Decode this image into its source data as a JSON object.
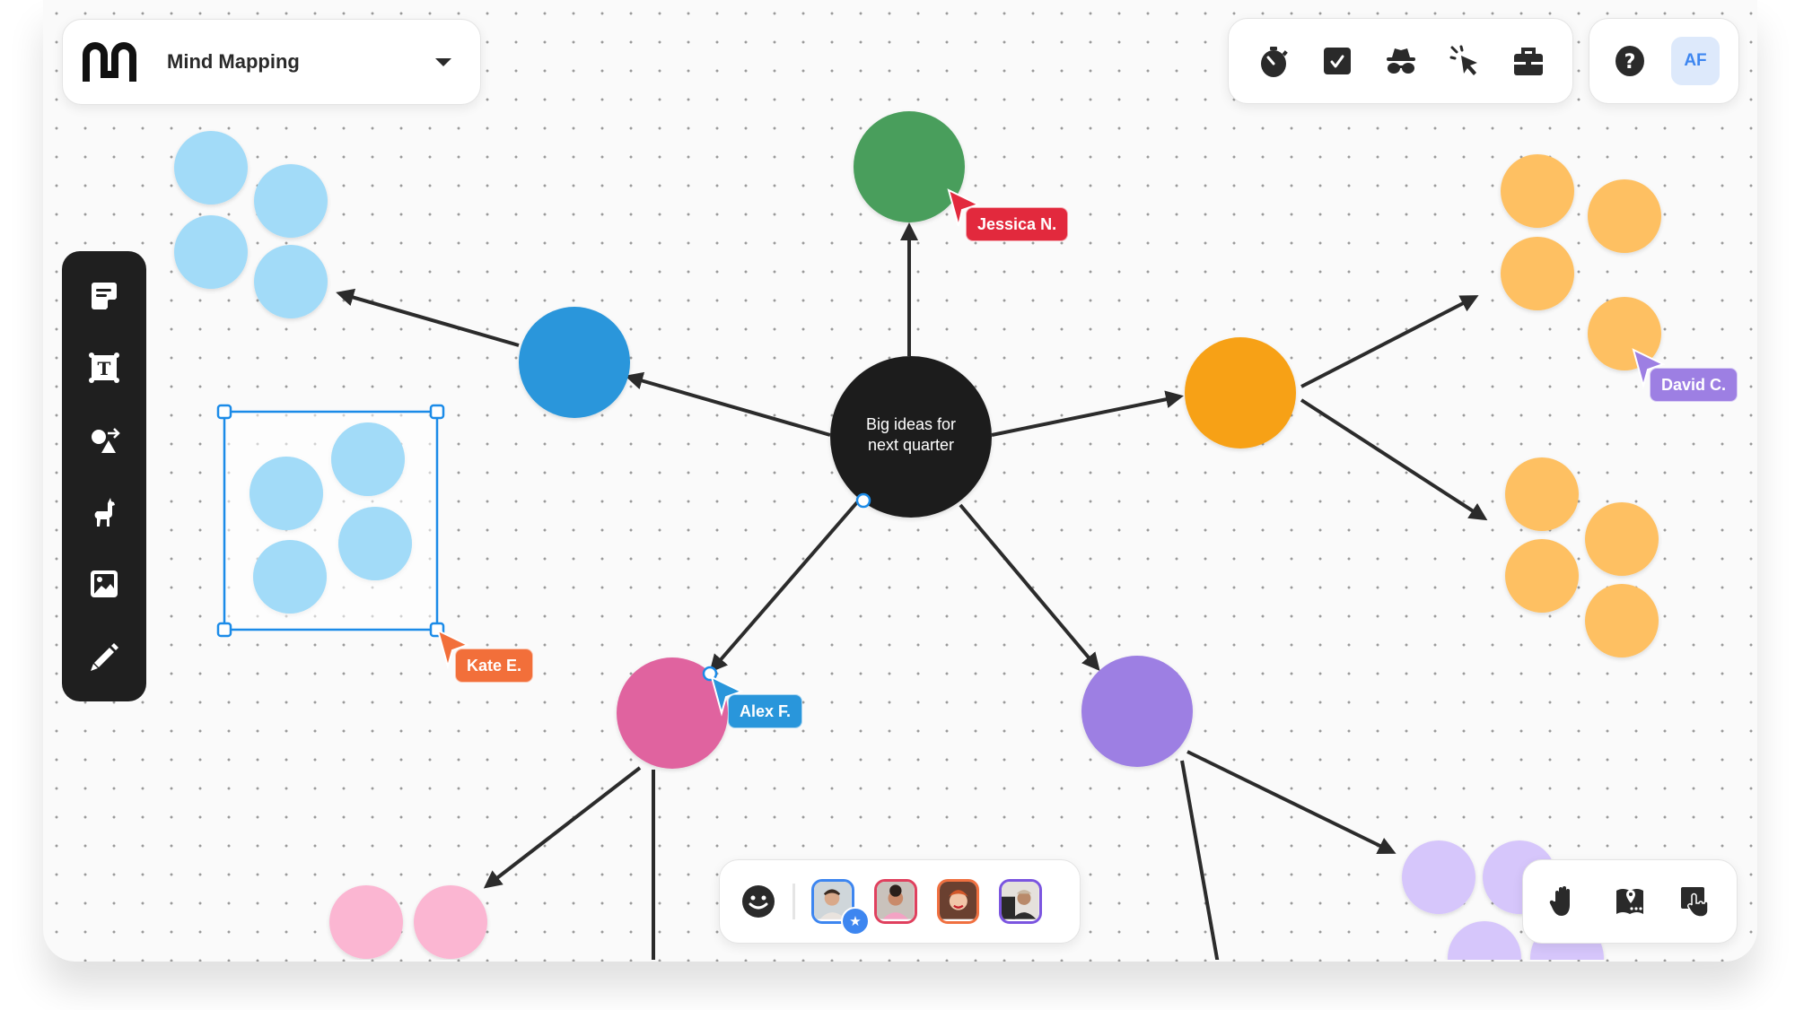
{
  "header": {
    "logo": "miro-style-logo",
    "title": "Mind Mapping",
    "dropdown_icon": "caret-down-icon"
  },
  "top_tools": [
    {
      "name": "timer",
      "icon": "stopwatch-icon"
    },
    {
      "name": "voting",
      "icon": "checkbox-icon"
    },
    {
      "name": "private-mode",
      "icon": "incognito-icon"
    },
    {
      "name": "attention",
      "icon": "cursor-click-icon"
    },
    {
      "name": "toolkit",
      "icon": "toolbox-icon"
    }
  ],
  "user_area": {
    "help_icon": "help-circle-icon",
    "avatar_initials": "AF",
    "avatar_color": "#3d86f0"
  },
  "left_toolbar": [
    {
      "name": "sticky-note",
      "icon": "sticky-note-icon"
    },
    {
      "name": "text",
      "icon": "text-box-icon"
    },
    {
      "name": "shapes",
      "icon": "shapes-arrow-icon"
    },
    {
      "name": "templates",
      "icon": "llama-icon"
    },
    {
      "name": "image",
      "icon": "image-icon"
    },
    {
      "name": "pen",
      "icon": "pencil-icon"
    }
  ],
  "mind_map": {
    "central_node": {
      "text_line1": "Big ideas for",
      "text_line2": "next quarter",
      "color": "#1f1f1f"
    },
    "branches": [
      {
        "name": "green",
        "color": "#4a9e5c"
      },
      {
        "name": "blue",
        "color": "#2996db"
      },
      {
        "name": "orange",
        "color": "#f7a116"
      },
      {
        "name": "pink",
        "color": "#e0649f"
      },
      {
        "name": "purple",
        "color": "#9d7fe3"
      }
    ],
    "leaf_colors": {
      "light_blue": "#a2dbf8",
      "light_orange": "#fec062",
      "light_pink": "#fbb6d2",
      "lavender": "#d6c6fb"
    }
  },
  "collaborator_cursors": [
    {
      "name": "Jessica N.",
      "color": "#e2293d"
    },
    {
      "name": "David C.",
      "color": "#9d7fe3"
    },
    {
      "name": "Kate E.",
      "color": "#f26f3a"
    },
    {
      "name": "Alex F.",
      "color": "#2996db"
    }
  ],
  "collaborators_bar": {
    "reaction_icon": "smiley-icon",
    "people": [
      {
        "border": "#3d86f0",
        "is_host": true
      },
      {
        "border": "#e0405e",
        "is_host": false
      },
      {
        "border": "#f07040",
        "is_host": false
      },
      {
        "border": "#7b55e0",
        "is_host": false
      }
    ]
  },
  "bottom_nav": [
    {
      "name": "hand",
      "icon": "raise-hand-icon"
    },
    {
      "name": "map",
      "icon": "map-pin-icon"
    },
    {
      "name": "touch",
      "icon": "touch-icon"
    }
  ]
}
